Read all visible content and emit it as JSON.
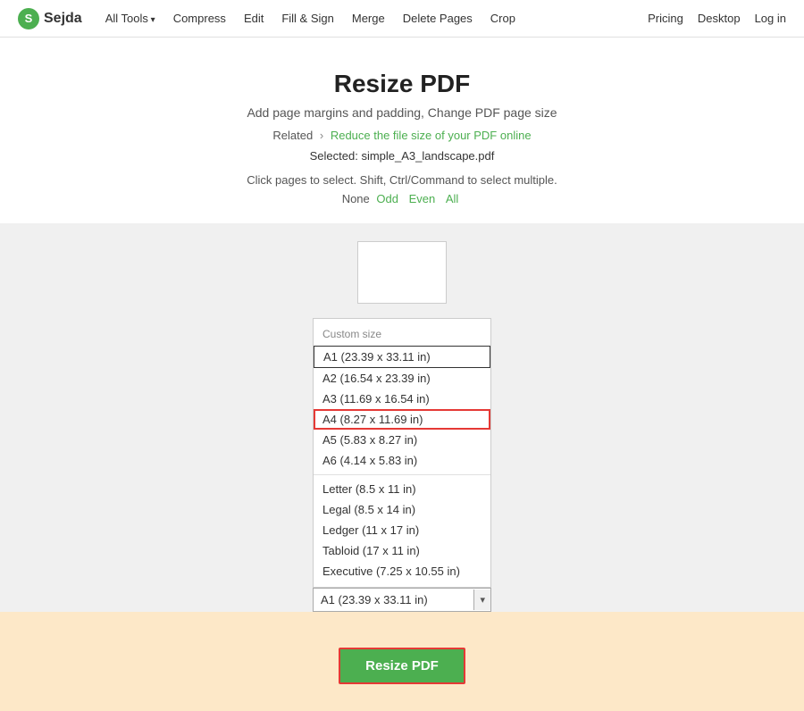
{
  "nav": {
    "logo_letter": "S",
    "logo_text": "Sejda",
    "items": [
      {
        "label": "All Tools",
        "has_arrow": true
      },
      {
        "label": "Compress",
        "has_arrow": false
      },
      {
        "label": "Edit",
        "has_arrow": false
      },
      {
        "label": "Fill & Sign",
        "has_arrow": false
      },
      {
        "label": "Merge",
        "has_arrow": false
      },
      {
        "label": "Delete Pages",
        "has_arrow": false
      },
      {
        "label": "Crop",
        "has_arrow": false
      }
    ],
    "right_items": [
      {
        "label": "Pricing"
      },
      {
        "label": "Desktop"
      },
      {
        "label": "Log in"
      }
    ]
  },
  "header": {
    "title": "Resize PDF",
    "subtitle": "Add page margins and padding, Change PDF page size",
    "related_label": "Related",
    "related_link": "Reduce the file size of your PDF online",
    "selected_label": "Selected:",
    "selected_file": "simple_A3_landscape.pdf",
    "instruction": "Click pages to select. Shift, Ctrl/Command to select multiple.",
    "page_select": {
      "none_label": "None",
      "odd_label": "Odd",
      "even_label": "Even",
      "all_label": "All"
    }
  },
  "dropdown": {
    "label": "Custom size",
    "options": [
      {
        "text": "A1 (23.39 x 33.11 in)",
        "state": "first"
      },
      {
        "text": "A2 (16.54 x 23.39 in)",
        "state": "normal"
      },
      {
        "text": "A3 (11.69 x 16.54 in)",
        "state": "normal"
      },
      {
        "text": "A4 (8.27 x 11.69 in)",
        "state": "highlighted"
      },
      {
        "text": "A5 (5.83 x 8.27 in)",
        "state": "normal"
      },
      {
        "text": "A6 (4.14 x 5.83 in)",
        "state": "normal"
      },
      {
        "text": "divider",
        "state": "divider"
      },
      {
        "text": "Letter (8.5 x 11 in)",
        "state": "normal"
      },
      {
        "text": "Legal (8.5 x 14 in)",
        "state": "normal"
      },
      {
        "text": "Ledger (11 x 17 in)",
        "state": "normal"
      },
      {
        "text": "Tabloid (17 x 11 in)",
        "state": "normal"
      },
      {
        "text": "Executive (7.25 x 10.55 in)",
        "state": "normal"
      }
    ],
    "select_value": "A1 (23.39 x 33.11 in)",
    "select_arrow": "▾"
  },
  "actions": {
    "resize_btn_label": "Resize PDF"
  }
}
